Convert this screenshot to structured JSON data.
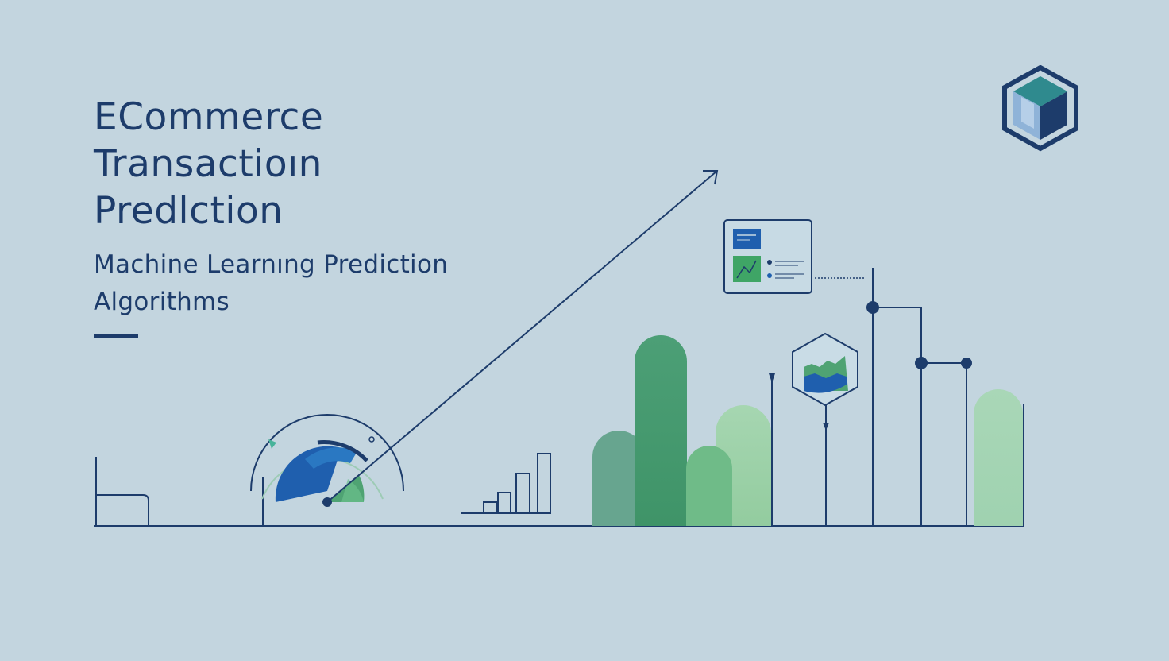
{
  "title_lines": [
    "ECommerce",
    "Transactioın",
    "Predlction"
  ],
  "subtitle_lines": [
    "Machine Learnıng Prediction",
    "Algorithms"
  ],
  "colors": {
    "background": "#c3d5df",
    "navy": "#1d3c6b",
    "blue": "#1f5fae",
    "green": "#4fa373",
    "green_light": "#93cfa5",
    "teal": "#67a58f"
  },
  "icons": [
    "cube-logo-icon",
    "gauge-icon",
    "trend-arrow-icon",
    "dashboard-card-icon",
    "hexagon-chart-icon",
    "building-icon"
  ]
}
